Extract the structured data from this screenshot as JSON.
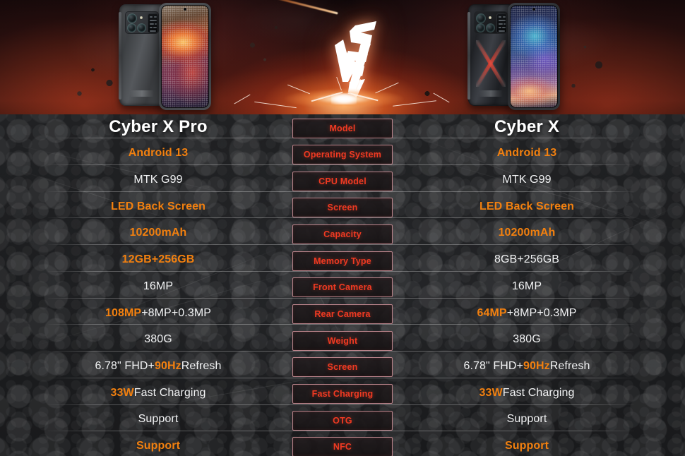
{
  "hero": {
    "vs_logo": "VS",
    "left_phone_name": "Cyber X Pro",
    "right_phone_name": "Cyber X"
  },
  "comparison": {
    "left_title": "Cyber X Pro",
    "right_title": "Cyber X",
    "center_labels": [
      "Model",
      "Operating System",
      "CPU Model",
      "Screen",
      "Capacity",
      "Memory Type",
      "Front Camera",
      "Rear Camera",
      "Weight",
      "Screen",
      "Fast Charging",
      "OTG",
      "NFC"
    ],
    "left_values": [
      "Cyber X Pro",
      "Android 13",
      "MTK G99",
      "LED Back Screen",
      "10200mAh",
      "12GB+256GB",
      "16MP",
      "108MP+8MP+0.3MP",
      "380G",
      "6.78\" FHD+ 90Hz Refresh",
      "33W Fast Charging",
      "Support",
      "Support"
    ],
    "right_values": [
      "Cyber X",
      "Android 13",
      "MTK G99",
      "LED Back Screen",
      "10200mAh",
      "8GB+256GB",
      "16MP",
      "64MP+8MP+0.3MP",
      "380G",
      "6.78\" FHD+ 90Hz Refresh",
      "33W Fast Charging",
      "Support",
      "Support"
    ],
    "left_rear_camera_parts": {
      "highlight": "108MP",
      "rest": "+8MP+0.3MP"
    },
    "right_rear_camera_parts": {
      "highlight": "64MP",
      "rest": "+8MP+0.3MP"
    },
    "screen_spec_parts": {
      "pre": "6.78\" FHD+ ",
      "highlight": "90Hz",
      "post": " Refresh"
    },
    "charging_spec_parts": {
      "highlight": "33W",
      "post": " Fast Charging"
    }
  },
  "colors": {
    "accent_orange": "#f2800f",
    "label_red": "#ef3a22",
    "label_border": "#b9838a",
    "text_white": "#f2f3f4",
    "table_bg": "#1c1d1f"
  }
}
